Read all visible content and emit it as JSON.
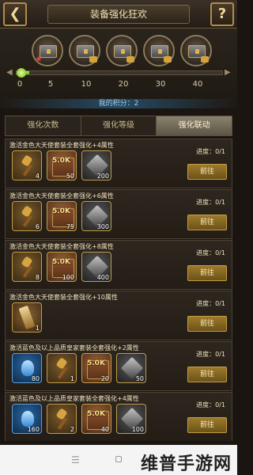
{
  "header": {
    "back_icon": "back-arrow-icon",
    "title": "装备强化狂欢",
    "help_label": "?"
  },
  "progress": {
    "ticks": [
      "0",
      "5",
      "10",
      "20",
      "30",
      "40"
    ],
    "fill_fraction": 0.06,
    "points_text": "我的积分：2"
  },
  "tabs": [
    {
      "label": "强化次数",
      "active": false
    },
    {
      "label": "强化等级",
      "active": false
    },
    {
      "label": "强化联动",
      "active": true
    }
  ],
  "tasks": [
    {
      "title": "激活金色大天使套装全套强化+4属性",
      "progress": "进度：0/1",
      "button": "前往",
      "items": [
        {
          "icon": "hammer-icon",
          "type": "hammer",
          "count": "4"
        },
        {
          "icon": "book-5k-icon",
          "type": "book",
          "tag": "5.0K",
          "count": "50"
        },
        {
          "icon": "ore-icon",
          "type": "ore",
          "count": "200"
        }
      ]
    },
    {
      "title": "激活金色大天使套装全套强化+6属性",
      "progress": "进度：0/1",
      "button": "前往",
      "items": [
        {
          "icon": "hammer-icon",
          "type": "hammer",
          "count": "6"
        },
        {
          "icon": "book-5k-icon",
          "type": "book",
          "tag": "5.0K",
          "count": "75"
        },
        {
          "icon": "ore-icon",
          "type": "ore",
          "count": "300"
        }
      ]
    },
    {
      "title": "激活金色大天使套装全套强化+8属性",
      "progress": "进度：0/1",
      "button": "前往",
      "items": [
        {
          "icon": "hammer-icon",
          "type": "hammer",
          "count": "8"
        },
        {
          "icon": "book-5k-icon",
          "type": "book",
          "tag": "5.0K",
          "count": "100"
        },
        {
          "icon": "ore-icon",
          "type": "ore",
          "count": "400"
        }
      ]
    },
    {
      "title": "激活金色大天使套装全套强化+10属性",
      "progress": "进度：0/1",
      "button": "前往",
      "items": [
        {
          "icon": "dagger-icon",
          "type": "dagger",
          "count": "1"
        }
      ]
    },
    {
      "title": "激活蓝色及以上品质皇家套装全套强化+2属性",
      "progress": "进度：0/1",
      "button": "前往",
      "items": [
        {
          "icon": "blue-gem-icon",
          "type": "blue",
          "count": "80"
        },
        {
          "icon": "hammer-icon",
          "type": "hammer",
          "count": "1"
        },
        {
          "icon": "book-5k-icon",
          "type": "book",
          "tag": "5.0K",
          "count": "20"
        },
        {
          "icon": "ore-icon",
          "type": "ore",
          "count": "50"
        }
      ]
    },
    {
      "title": "激活蓝色及以上品质皇家套装全套强化+4属性",
      "progress": "进度：0/1",
      "button": "前往",
      "items": [
        {
          "icon": "blue-gem-icon",
          "type": "blue",
          "count": "160"
        },
        {
          "icon": "hammer-icon",
          "type": "hammer",
          "count": "2"
        },
        {
          "icon": "book-5k-icon",
          "type": "book",
          "tag": "5.0K",
          "count": "40"
        },
        {
          "icon": "ore-icon",
          "type": "ore",
          "count": "100"
        }
      ]
    }
  ],
  "nav": {
    "menu_icon": "menu-icon",
    "home_icon": "home-icon"
  },
  "watermark": "维普手游网",
  "colors": {
    "accent": "#c59c48",
    "progress_fill": "#8ed42a",
    "points_text": "#9fd0ee"
  }
}
